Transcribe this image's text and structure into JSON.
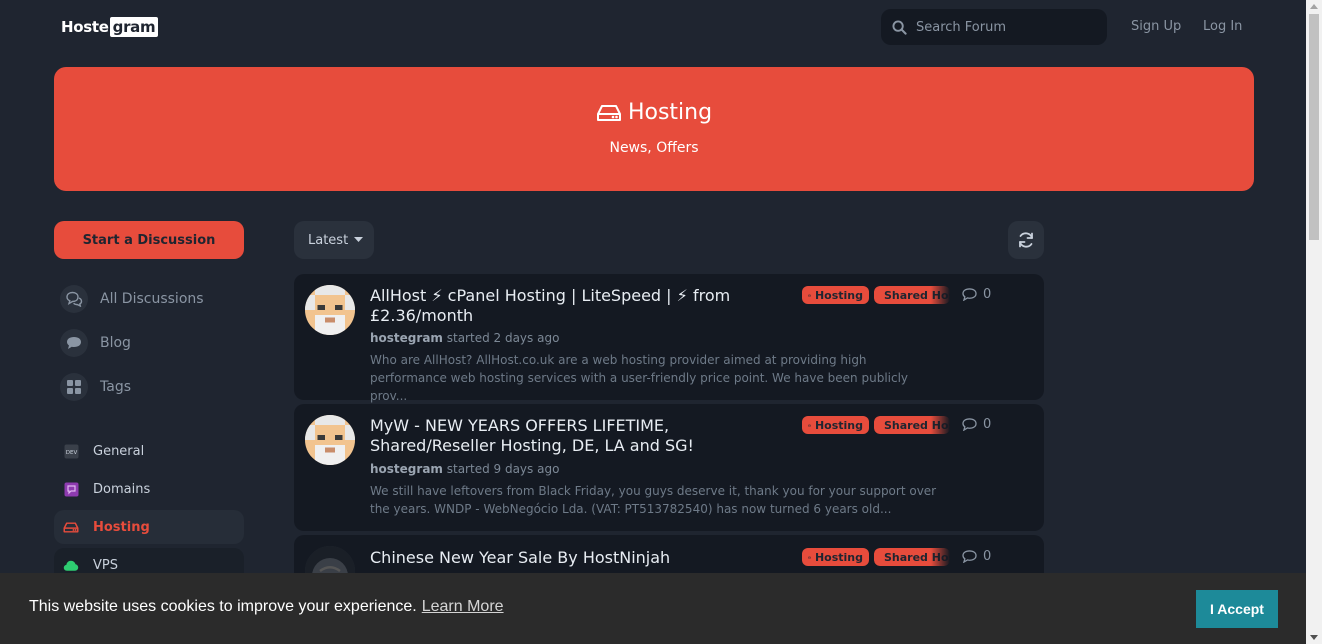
{
  "header": {
    "logo_part1": "Hoste",
    "logo_part2": "gram",
    "search_placeholder": "Search Forum",
    "signup": "Sign Up",
    "login": "Log In"
  },
  "hero": {
    "icon": "hdd-icon",
    "title": "Hosting",
    "subtitle": "News, Offers"
  },
  "sidebar": {
    "start_button": "Start a Discussion",
    "nav": [
      {
        "label": "All Discussions",
        "icon": "comments-icon"
      },
      {
        "label": "Blog",
        "icon": "comment-icon"
      },
      {
        "label": "Tags",
        "icon": "grid-icon"
      }
    ],
    "tags": [
      {
        "label": "General",
        "icon": "dev-icon"
      },
      {
        "label": "Domains",
        "icon": "domain-icon"
      },
      {
        "label": "Hosting",
        "icon": "hdd-icon",
        "active": true
      },
      {
        "label": "VPS",
        "icon": "cloud-icon"
      }
    ]
  },
  "toolbar": {
    "sort_label": "Latest"
  },
  "discussions": [
    {
      "title": "AllHost ⚡ cPanel Hosting | LiteSpeed | ⚡ from £2.36/month",
      "author": "hostegram",
      "meta": "started 2 days ago",
      "excerpt": "Who are AllHost? AllHost.co.uk are a web hosting provider aimed at providing high performance web hosting services with a user-friendly price point. We have been publicly prov...",
      "tag1": "Hosting",
      "tag2": "Shared Hosting",
      "replies": "0"
    },
    {
      "title": "MyW - NEW YEARS OFFERS LIFETIME, Shared/Reseller Hosting, DE, LA and SG!",
      "author": "hostegram",
      "meta": "started 9 days ago",
      "excerpt": "We still have leftovers from Black Friday, you guys deserve it, thank you for your support over the years. WNDP - WebNegócio Lda. (VAT: PT513782540) has now turned 6 years old...",
      "tag1": "Hosting",
      "tag2": "Shared Hosting",
      "replies": "0"
    },
    {
      "title": "Chinese New Year Sale By HostNinjah",
      "author": "",
      "meta": "",
      "excerpt": "",
      "tag1": "Hosting",
      "tag2": "Shared Hosting",
      "replies": "0"
    }
  ],
  "cookie": {
    "message": "This website uses cookies to improve your experience.",
    "link": "Learn More",
    "accept": "I Accept"
  },
  "colors": {
    "accent": "#e74c3c",
    "background": "#1f2530",
    "card": "#141922",
    "cookie_button": "#1d8a99"
  }
}
